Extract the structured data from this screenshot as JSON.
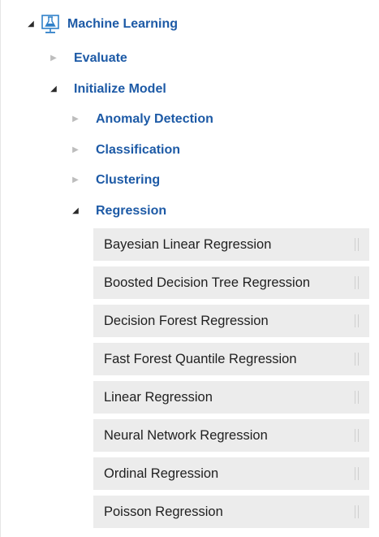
{
  "tree": {
    "root": {
      "label": "Machine Learning",
      "expanded": true,
      "icon": "flask-icon"
    },
    "children": [
      {
        "label": "Evaluate",
        "expanded": false
      },
      {
        "label": "Initialize Model",
        "expanded": true
      }
    ],
    "init_model_children": [
      {
        "label": "Anomaly Detection",
        "expanded": false
      },
      {
        "label": "Classification",
        "expanded": false
      },
      {
        "label": "Clustering",
        "expanded": false
      },
      {
        "label": "Regression",
        "expanded": true
      }
    ],
    "regression_modules": [
      "Bayesian Linear Regression",
      "Boosted Decision Tree Regression",
      "Decision Forest Regression",
      "Fast Forest Quantile Regression",
      "Linear Regression",
      "Neural Network Regression",
      "Ordinal Regression",
      "Poisson Regression"
    ]
  },
  "colors": {
    "category_text": "#1d5aa6",
    "icon_blue": "#2f80c9",
    "module_bg": "#ececec",
    "arrow_collapsed": "#bdbdbd",
    "arrow_expanded": "#2b2b2b"
  }
}
